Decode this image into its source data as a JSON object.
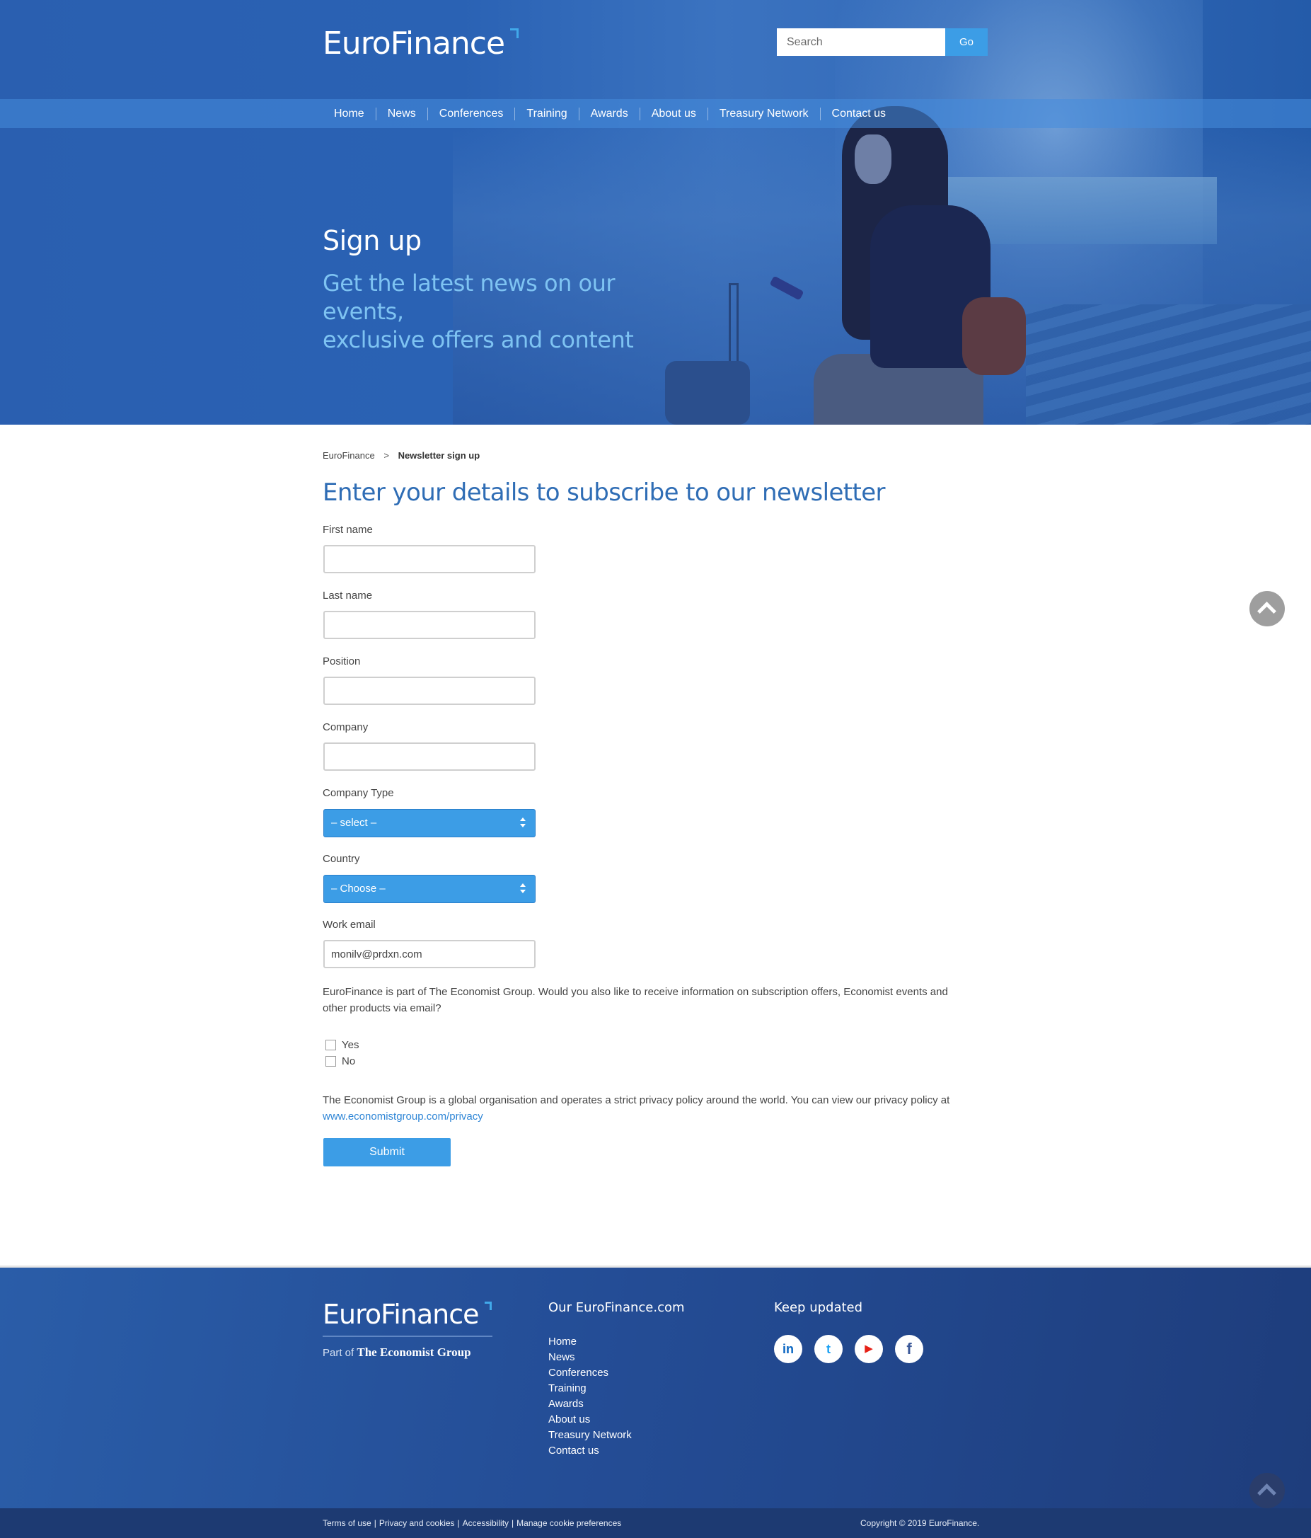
{
  "header": {
    "logo_text": "EuroFinance",
    "search_placeholder": "Search",
    "go_label": "Go",
    "nav": [
      "Home",
      "News",
      "Conferences",
      "Training",
      "Awards",
      "About us",
      "Treasury Network",
      "Contact us"
    ]
  },
  "hero": {
    "title": "Sign up",
    "subtitle_line1": "Get the latest news on our events,",
    "subtitle_line2": "exclusive offers and content"
  },
  "breadcrumb": {
    "home": "EuroFinance",
    "separator": ">",
    "current": "Newsletter sign up"
  },
  "form": {
    "heading": "Enter your details to subscribe to our newsletter",
    "first_name_label": "First name",
    "first_name_value": "",
    "last_name_label": "Last name",
    "last_name_value": "",
    "position_label": "Position",
    "position_value": "",
    "company_label": "Company",
    "company_value": "",
    "company_type_label": "Company Type",
    "company_type_value": "– select –",
    "country_label": "Country",
    "country_value": "– Choose –",
    "work_email_label": "Work email",
    "work_email_value": "monilv@prdxn.com",
    "consent_text": "EuroFinance is part of The Economist Group. Would you also like to receive information on subscription offers, Economist events and other products via email?",
    "option_yes": "Yes",
    "option_no": "No",
    "privacy_text": "The Economist Group is a global organisation and operates a strict privacy policy around the world. You can view our privacy policy at",
    "privacy_link": "www.economistgroup.com/privacy",
    "submit_label": "Submit"
  },
  "footer": {
    "logo_text": "EuroFinance",
    "part_of": "Part of",
    "group_name": "The Economist Group",
    "links_heading": "Our EuroFinance.com",
    "links": [
      "Home",
      "News",
      "Conferences",
      "Training",
      "Awards",
      "About us",
      "Treasury Network",
      "Contact us"
    ],
    "social_heading": "Keep updated",
    "social": [
      {
        "name": "linkedin-icon",
        "glyph": "in",
        "color": "#0a66c2"
      },
      {
        "name": "twitter-icon",
        "glyph": "t",
        "color": "#1da1f2"
      },
      {
        "name": "youtube-icon",
        "glyph": "▶",
        "color": "#e62117"
      },
      {
        "name": "facebook-icon",
        "glyph": "f",
        "color": "#3b5998"
      }
    ],
    "legal_links": [
      "Terms of use",
      "Privacy and cookies",
      "Accessibility",
      "Manage cookie preferences"
    ],
    "copyright": "Copyright © 2019 EuroFinance."
  },
  "colors": {
    "accent": "#3c9de6",
    "heading_blue": "#2f6db5",
    "hero_subtitle": "#7ec3f2",
    "footer_bg": "#244d96"
  }
}
